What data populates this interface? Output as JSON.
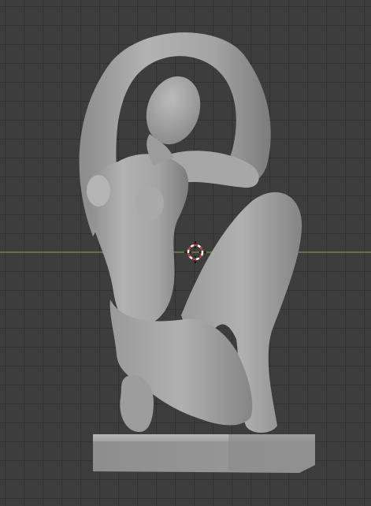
{
  "viewport": {
    "mode": "3d-viewport",
    "background_color": "#3d3d3d",
    "grid_color": "#353535",
    "x_axis_color": "#6d8a3a",
    "object": {
      "icon": "sculpture-mesh",
      "material_color": "#a6a6a6",
      "shading": "solid"
    },
    "cursor_3d": {
      "icon": "3d-cursor-icon",
      "ring_colors": [
        "#ffffff",
        "#d23b3b"
      ]
    }
  }
}
